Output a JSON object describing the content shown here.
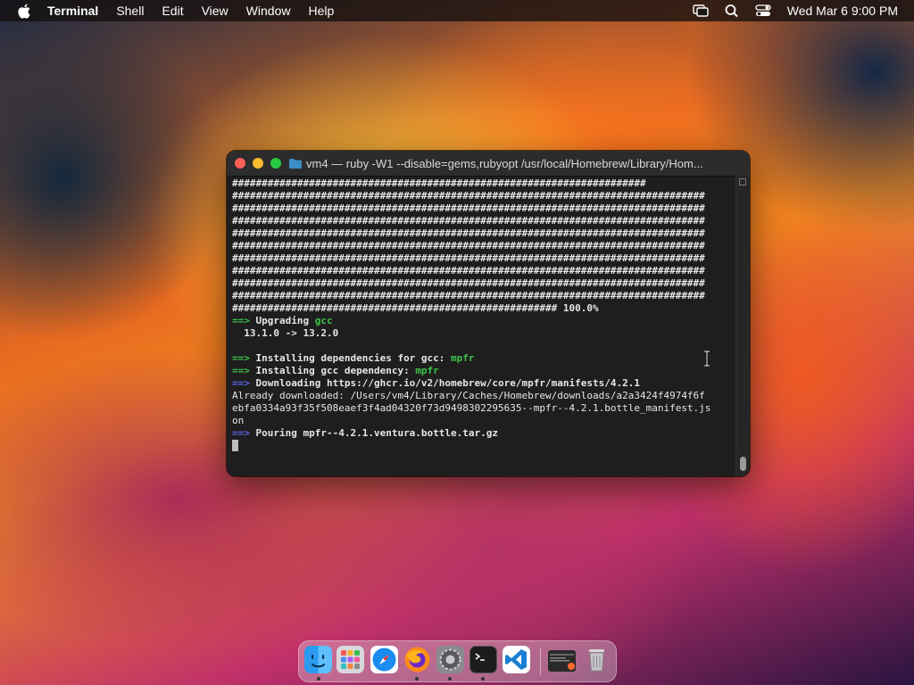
{
  "menubar": {
    "app_name": "Terminal",
    "items": [
      "Shell",
      "Edit",
      "View",
      "Window",
      "Help"
    ],
    "clock": "Wed Mar 6  9:00 PM",
    "status_icons": [
      "screen-mirroring-icon",
      "search-icon",
      "control-center-icon"
    ]
  },
  "terminal": {
    "title": "vm4 — ruby -W1 --disable=gems,rubyopt /usr/local/Homebrew/Library/Hom...",
    "lines": [
      "######################################################################",
      "################################################################################",
      "################################################################################",
      "################################################################################",
      "################################################################################",
      "################################################################################",
      "################################################################################",
      "################################################################################",
      "################################################################################",
      "################################################################################",
      "####################################################### 100.0%"
    ],
    "upgrading_prefix": "==>",
    "upgrading_label": "Upgrading",
    "upgrading_pkg": "gcc",
    "version_line": "  13.1.0 -> 13.2.0",
    "deps_label": "Installing dependencies for gcc:",
    "deps_pkg": "mpfr",
    "dep_label": "Installing gcc dependency:",
    "dep_pkg": "mpfr",
    "download_label": "Downloading https://ghcr.io/v2/homebrew/core/mpfr/manifests/4.2.1",
    "already_1": "Already downloaded: /Users/vm4/Library/Caches/Homebrew/downloads/a2a3424f4974f6f",
    "already_2": "ebfa0334a93f35f508eaef3f4ad04320f73d9498302295635--mpfr--4.2.1.bottle_manifest.js",
    "already_3": "on",
    "pouring_label": "Pouring mpfr--4.2.1.ventura.bottle.tar.gz"
  },
  "dock": {
    "apps": [
      "Finder",
      "Launchpad",
      "Safari",
      "Firefox",
      "System Settings",
      "Terminal",
      "Visual Studio Code",
      "Terminal window",
      "Trash"
    ]
  },
  "colors": {
    "prompt_green": "#3ec24a",
    "prompt_blue": "#5a62e8",
    "terminal_bg": "#1e1e1e"
  }
}
